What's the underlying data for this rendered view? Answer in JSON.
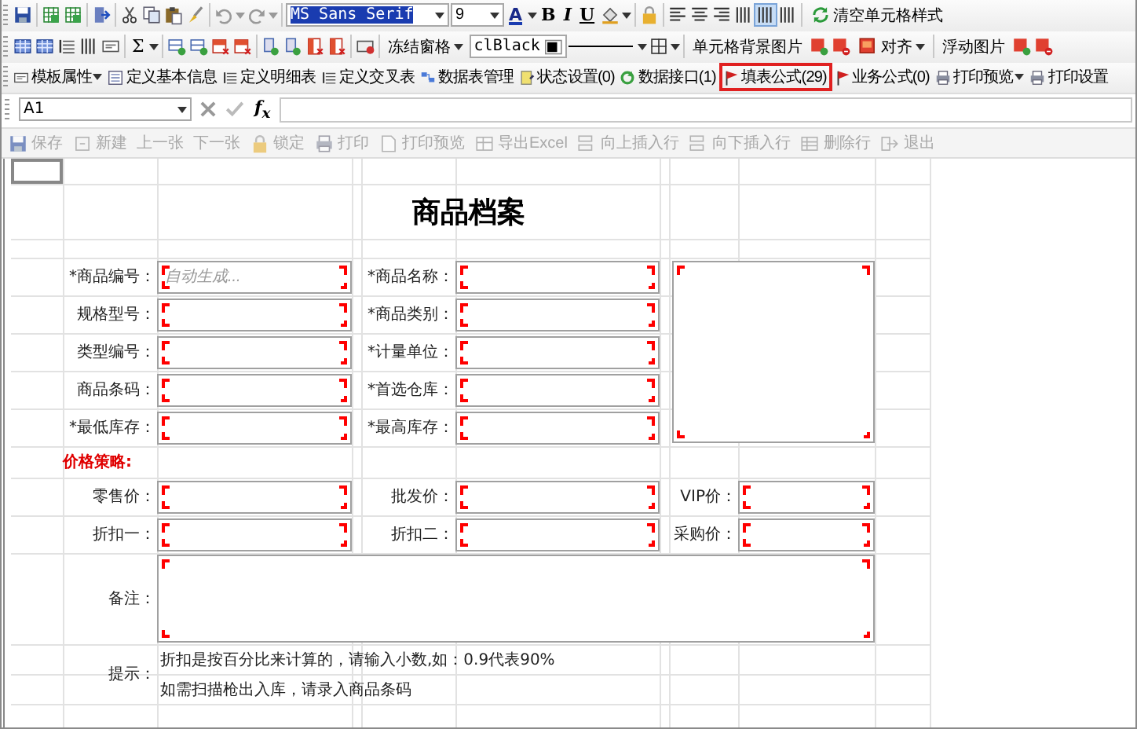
{
  "format_toolbar": {
    "font": "MS Sans Serif",
    "font_size": "9",
    "color_letter": "A",
    "bold": "B",
    "italic": "I",
    "underline": "U",
    "column_modes": [
      {
        "selected": false
      },
      {
        "selected": true
      },
      {
        "selected": false
      }
    ],
    "clear_style": "清空单元格样式"
  },
  "layout_toolbar": {
    "sigma": "Σ",
    "freeze": "冻结窗格",
    "color_value": "clBlack",
    "cell_bg_image": "单元格背景图片",
    "align": "对齐",
    "float_image": "浮动图片"
  },
  "design_toolbar": [
    {
      "label": "模板属性",
      "dropdown": true,
      "highlighted": false
    },
    {
      "label": "定义基本信息",
      "dropdown": false,
      "highlighted": false
    },
    {
      "label": "定义明细表",
      "dropdown": false,
      "highlighted": false
    },
    {
      "label": "定义交叉表",
      "dropdown": false,
      "highlighted": false
    },
    {
      "label": "数据表管理",
      "dropdown": false,
      "highlighted": false
    },
    {
      "label": "状态设置(0)",
      "dropdown": false,
      "highlighted": false
    },
    {
      "label": "数据接口(1)",
      "dropdown": false,
      "highlighted": false
    },
    {
      "label": "填表公式(29)",
      "dropdown": false,
      "highlighted": true
    },
    {
      "label": "业务公式(0)",
      "dropdown": false,
      "highlighted": false
    },
    {
      "label": "打印预览",
      "dropdown": true,
      "highlighted": false
    },
    {
      "label": "打印设置",
      "dropdown": false,
      "highlighted": false
    }
  ],
  "formula_bar": {
    "cell_ref": "A1",
    "fx": "f$_{x}$"
  },
  "action_bar": [
    {
      "label": "保存",
      "disabled": true
    },
    {
      "label": "新建",
      "disabled": true
    },
    {
      "label": "上一张",
      "disabled": true
    },
    {
      "label": "下一张",
      "disabled": true
    },
    {
      "label": "锁定",
      "disabled": true
    },
    {
      "label": "打印",
      "disabled": true
    },
    {
      "label": "打印预览",
      "disabled": true
    },
    {
      "label": "导出Excel",
      "disabled": true
    },
    {
      "label": "向上插入行",
      "disabled": true
    },
    {
      "label": "向下插入行",
      "disabled": true
    },
    {
      "label": "删除行",
      "disabled": true
    },
    {
      "label": "退出",
      "disabled": true
    }
  ],
  "form": {
    "title": "商品档案",
    "rows": [
      [
        {
          "label": "*商品编号：",
          "placeholder": "自动生成..."
        },
        {
          "label": "*商品名称："
        }
      ],
      [
        {
          "label": "规格型号："
        },
        {
          "label": "*商品类别："
        }
      ],
      [
        {
          "label": "类型编号："
        },
        {
          "label": "*计量单位："
        }
      ],
      [
        {
          "label": "商品条码："
        },
        {
          "label": "*首选仓库："
        }
      ],
      [
        {
          "label": "*最低库存："
        },
        {
          "label": "*最高库存："
        }
      ]
    ],
    "price_heading": "价格策略:",
    "price_rows": [
      [
        {
          "label": "零售价："
        },
        {
          "label": "批发价："
        },
        {
          "label": "VIP价："
        }
      ],
      [
        {
          "label": "折扣一："
        },
        {
          "label": "折扣二："
        },
        {
          "label": "采购价："
        }
      ]
    ],
    "remark_label": "备注：",
    "hint_label": "提示：",
    "hints": [
      "折扣是按百分比来计算的，请输入小数,如：0.9代表90%",
      "如需扫描枪出入库，请录入商品条码"
    ]
  }
}
